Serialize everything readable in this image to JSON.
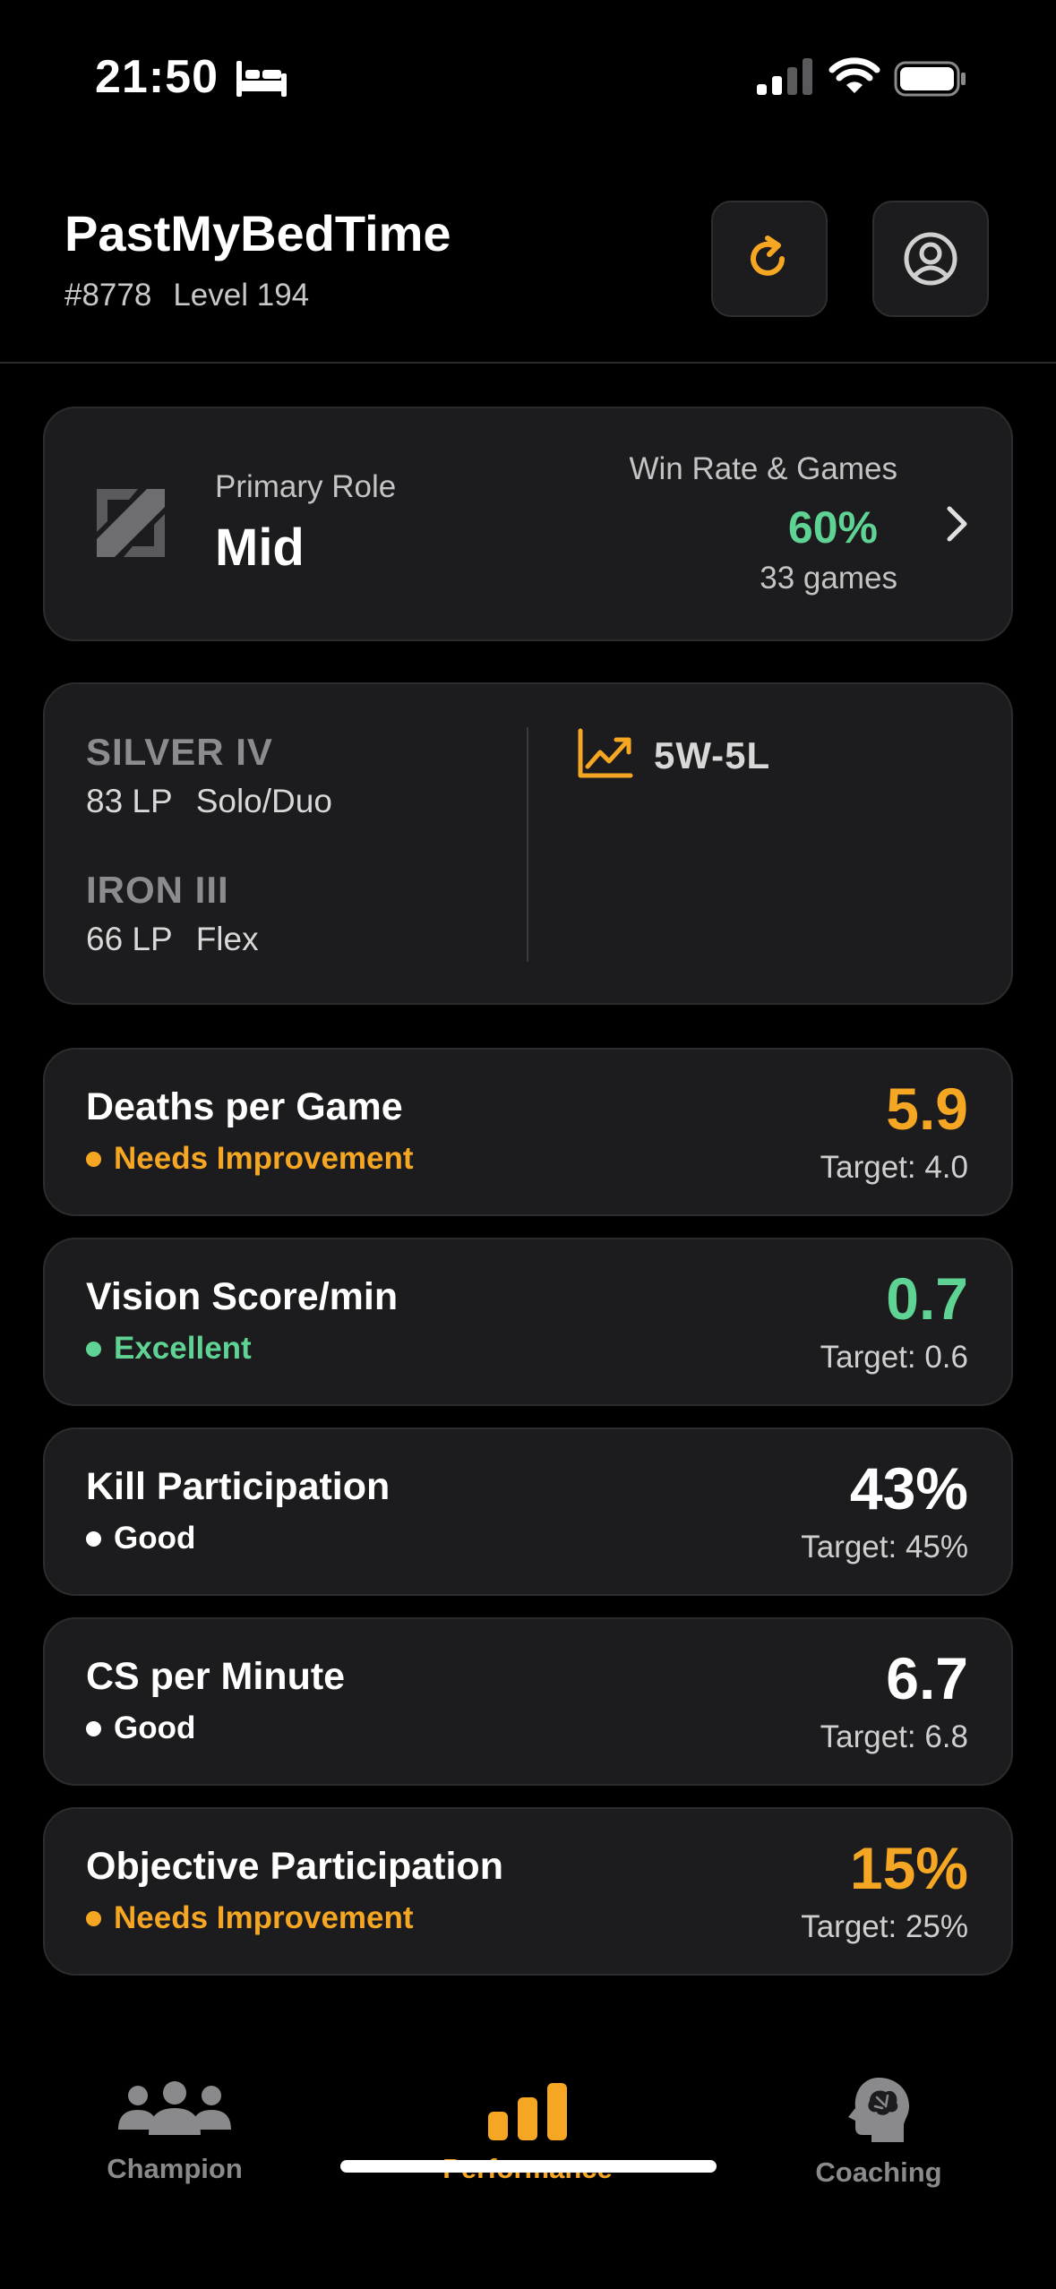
{
  "status_bar": {
    "time": "21:50"
  },
  "header": {
    "username": "PastMyBedTime",
    "tag": "#8778",
    "level": "Level 194"
  },
  "role_card": {
    "role_label": "Primary Role",
    "role_value": "Mid",
    "winrate_label": "Win Rate & Games",
    "winrate_value": "60%",
    "games": "33 games"
  },
  "rank_card": {
    "solo": {
      "tier": "SILVER IV",
      "lp": "83 LP",
      "queue": "Solo/Duo"
    },
    "flex": {
      "tier": "IRON III",
      "lp": "66 LP",
      "queue": "Flex"
    },
    "record": "5W-5L"
  },
  "metrics": [
    {
      "title": "Deaths per Game",
      "status": "Needs Improvement",
      "status_color": "#f5a623",
      "value": "5.9",
      "value_color": "#f5a623",
      "target": "Target: 4.0"
    },
    {
      "title": "Vision Score/min",
      "status": "Excellent",
      "status_color": "#5fd394",
      "value": "0.7",
      "value_color": "#5fd394",
      "target": "Target: 0.6"
    },
    {
      "title": "Kill Participation",
      "status": "Good",
      "status_color": "#ffffff",
      "value": "43%",
      "value_color": "#ffffff",
      "target": "Target: 45%"
    },
    {
      "title": "CS per Minute",
      "status": "Good",
      "status_color": "#ffffff",
      "value": "6.7",
      "value_color": "#ffffff",
      "target": "Target: 6.8"
    },
    {
      "title": "Objective Participation",
      "status": "Needs Improvement",
      "status_color": "#f5a623",
      "value": "15%",
      "value_color": "#f5a623",
      "target": "Target: 25%"
    }
  ],
  "tab_bar": {
    "tabs": [
      {
        "label": "Champion",
        "icon": "people-icon",
        "active": false
      },
      {
        "label": "Performance",
        "icon": "bar-chart-icon",
        "active": true
      },
      {
        "label": "Coaching",
        "icon": "brain-head-icon",
        "active": false
      }
    ]
  },
  "colors": {
    "accent": "#f5a623",
    "positive": "#5fd394",
    "card_bg": "#1c1c1e"
  }
}
